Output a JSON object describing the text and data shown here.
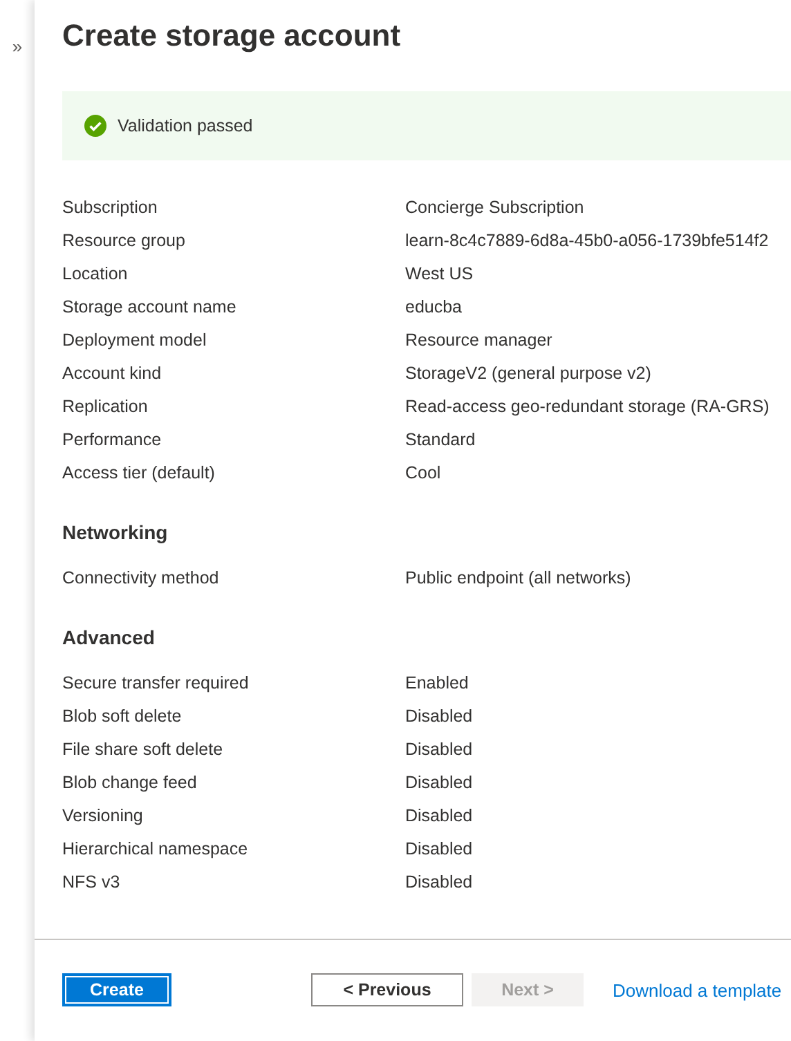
{
  "sidebar": {
    "expand_glyph": "»"
  },
  "title": "Create storage account",
  "validation": {
    "passed": true,
    "message": "Validation passed"
  },
  "sections": [
    {
      "rows": [
        {
          "label": "Subscription",
          "value": "Concierge Subscription"
        },
        {
          "label": "Resource group",
          "value": "learn-8c4c7889-6d8a-45b0-a056-1739bfe514f2"
        },
        {
          "label": "Location",
          "value": "West US"
        },
        {
          "label": "Storage account name",
          "value": "educba"
        },
        {
          "label": "Deployment model",
          "value": "Resource manager"
        },
        {
          "label": "Account kind",
          "value": "StorageV2 (general purpose v2)"
        },
        {
          "label": "Replication",
          "value": "Read-access geo-redundant storage (RA-GRS)"
        },
        {
          "label": "Performance",
          "value": "Standard"
        },
        {
          "label": "Access tier (default)",
          "value": "Cool"
        }
      ]
    },
    {
      "heading": "Networking",
      "rows": [
        {
          "label": "Connectivity method",
          "value": "Public endpoint (all networks)"
        }
      ]
    },
    {
      "heading": "Advanced",
      "rows": [
        {
          "label": "Secure transfer required",
          "value": "Enabled"
        },
        {
          "label": "Blob soft delete",
          "value": "Disabled"
        },
        {
          "label": "File share soft delete",
          "value": "Disabled"
        },
        {
          "label": "Blob change feed",
          "value": "Disabled"
        },
        {
          "label": "Versioning",
          "value": "Disabled"
        },
        {
          "label": "Hierarchical namespace",
          "value": "Disabled"
        },
        {
          "label": "NFS v3",
          "value": "Disabled"
        }
      ]
    }
  ],
  "footer": [
    {
      "kind": "primary",
      "label": "Create",
      "disabled": false
    },
    {
      "kind": "secondary",
      "label": "< Previous",
      "disabled": false
    },
    {
      "kind": "secondary",
      "label": "Next >",
      "disabled": true
    },
    {
      "kind": "link",
      "label": "Download a template"
    }
  ]
}
